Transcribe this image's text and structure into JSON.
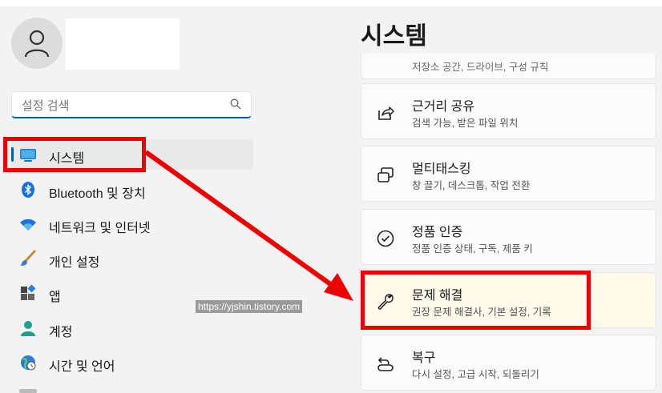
{
  "sidebar": {
    "search": {
      "placeholder": "설정 검색"
    },
    "items": [
      {
        "label": "시스템",
        "icon": "monitor-icon"
      },
      {
        "label": "Bluetooth 및 장치",
        "icon": "bluetooth-icon"
      },
      {
        "label": "네트워크 및 인터넷",
        "icon": "wifi-icon"
      },
      {
        "label": "개인 설정",
        "icon": "brush-icon"
      },
      {
        "label": "앱",
        "icon": "apps-icon"
      },
      {
        "label": "계정",
        "icon": "account-icon"
      },
      {
        "label": "시간 및 언어",
        "icon": "globe-clock-icon"
      }
    ]
  },
  "watermark": "https://yjshin.tistory.com",
  "main": {
    "title": "시스템",
    "partial_desc": "저장소 공간, 드라이브, 구성 규칙",
    "cards": [
      {
        "title": "근거리 공유",
        "desc": "검색 가능, 받은 파일 위치",
        "icon": "share-icon"
      },
      {
        "title": "멀티태스킹",
        "desc": "창 끌기, 데스크톱, 작업 전환",
        "icon": "multitask-icon"
      },
      {
        "title": "정품 인증",
        "desc": "정품 인증 상태, 구독, 제품 키",
        "icon": "check-circle-icon"
      },
      {
        "title": "문제 해결",
        "desc": "권장 문제 해결사, 기본 설정, 기록",
        "icon": "wrench-icon"
      },
      {
        "title": "복구",
        "desc": "다시 설정, 고급 시작, 되돌리기",
        "icon": "recovery-icon"
      }
    ]
  },
  "colors": {
    "accent": "#005fb8",
    "annotation": "#ee0000"
  }
}
